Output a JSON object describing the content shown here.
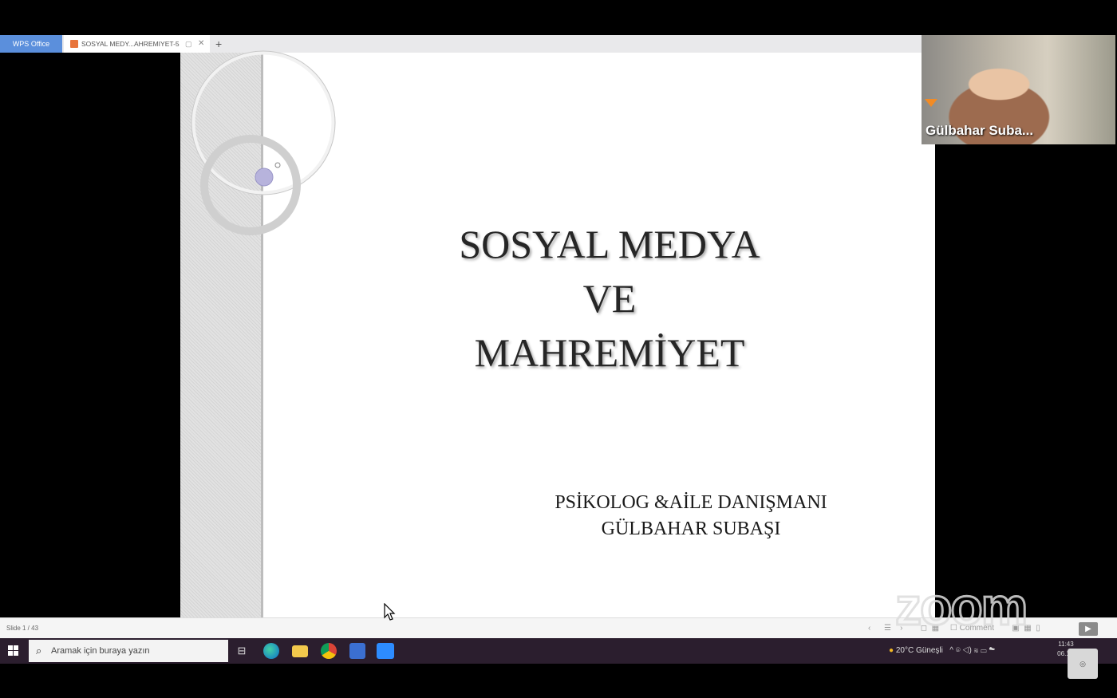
{
  "tabs": {
    "app_label": "WPS Office",
    "doc_label": "SOSYAL MEDY...AHREMIYET-5",
    "new_tab": "+"
  },
  "slide": {
    "title_lines": [
      "SOSYAL MEDYA",
      "VE",
      "MAHREMİYET"
    ],
    "presenter_lines": [
      "PSİKOLOG &AİLE DANIŞMANI",
      "GÜLBAHAR SUBAŞI"
    ]
  },
  "video": {
    "participant_name": "Gülbahar Suba..."
  },
  "statusbar": {
    "slide_counter": "Slide 1 / 43",
    "comment_label": "Comment"
  },
  "watermark": "zoom",
  "taskbar": {
    "search_placeholder": "Aramak için buraya yazın",
    "weather": "20°C  Güneşli",
    "time": "11:43",
    "date": "06.11."
  },
  "colors": {
    "wps_tab": "#5b8fdc",
    "taskbar": "#2b1e2e",
    "title_text": "#262626"
  }
}
